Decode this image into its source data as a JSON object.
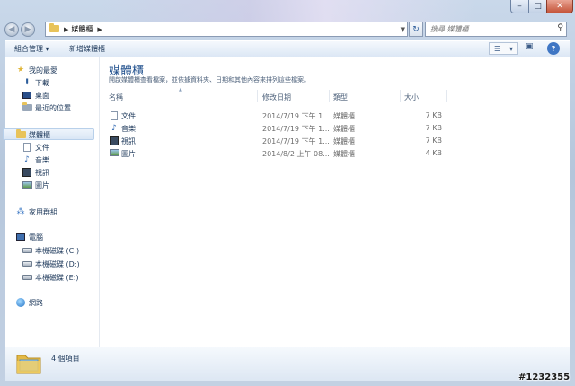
{
  "window": {
    "minimize_icon": "minimize-icon",
    "maximize_icon": "maximize-icon",
    "close_icon": "close-icon"
  },
  "address": {
    "path": "媒體櫃",
    "search_placeholder": "搜尋 媒體櫃"
  },
  "toolbar": {
    "organize": "組合管理 ▾",
    "new_library": "新增媒體櫃"
  },
  "nav": {
    "favorites": "我的最愛",
    "downloads": "下載",
    "desktop": "桌面",
    "recent": "最近的位置",
    "libraries": "媒體櫃",
    "lib_docs": "文件",
    "lib_music": "音樂",
    "lib_videos": "視訊",
    "lib_pictures": "圖片",
    "homegroup": "家用群組",
    "computer": "電腦",
    "drive_c": "本機磁碟 (C:)",
    "drive_d": "本機磁碟 (D:)",
    "drive_e": "本機磁碟 (E:)",
    "network": "網路"
  },
  "content": {
    "title": "媒體櫃",
    "description": "開啟媒體櫃查看檔案，並依據資料夾、日期和其他內容來排列這些檔案。",
    "columns": {
      "name": "名稱",
      "date": "修改日期",
      "type": "類型",
      "size": "大小"
    },
    "rows": [
      {
        "icon": "document-icon",
        "name": "文件",
        "date": "2014/7/19 下午 1...",
        "type": "媒體櫃",
        "size": "7 KB"
      },
      {
        "icon": "music-icon",
        "name": "音樂",
        "date": "2014/7/19 下午 1...",
        "type": "媒體櫃",
        "size": "7 KB"
      },
      {
        "icon": "video-icon",
        "name": "視訊",
        "date": "2014/7/19 下午 1...",
        "type": "媒體櫃",
        "size": "7 KB"
      },
      {
        "icon": "picture-icon",
        "name": "圖片",
        "date": "2014/8/2 上午 08...",
        "type": "媒體櫃",
        "size": "4 KB"
      }
    ]
  },
  "status": {
    "count": "4 個項目"
  },
  "watermark": "#1232355"
}
